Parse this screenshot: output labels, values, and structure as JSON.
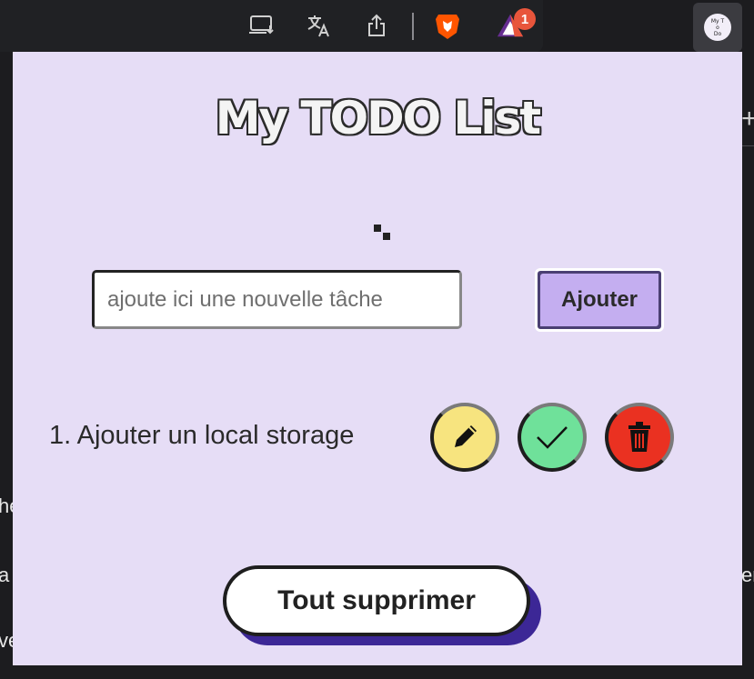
{
  "browser": {
    "icons": [
      "install-app-icon",
      "translate-icon",
      "share-icon",
      "brave-shields-icon",
      "brave-rewards-icon"
    ],
    "rewards_badge": "1",
    "extension_logo": [
      "My T",
      "o",
      "Do"
    ]
  },
  "background_page": {
    "left_fragments": [
      "he",
      "a",
      "ve"
    ],
    "right_fragment": "er"
  },
  "popup": {
    "title": "My TODO List",
    "input": {
      "value": "",
      "placeholder": "ajoute ici une nouvelle tâche"
    },
    "add_button": "Ajouter",
    "tasks": [
      {
        "label": "1. Ajouter un local storage",
        "actions": [
          "pencil-icon",
          "check-icon",
          "trash-icon"
        ]
      }
    ],
    "clear_all_button": "Tout supprimer",
    "colors": {
      "background": "#e6ddf6",
      "add_button": "#c4aef0",
      "edit": "#f7e47f",
      "done": "#6fe19a",
      "delete": "#ea3121",
      "clear_shadow": "#3c2796"
    }
  }
}
